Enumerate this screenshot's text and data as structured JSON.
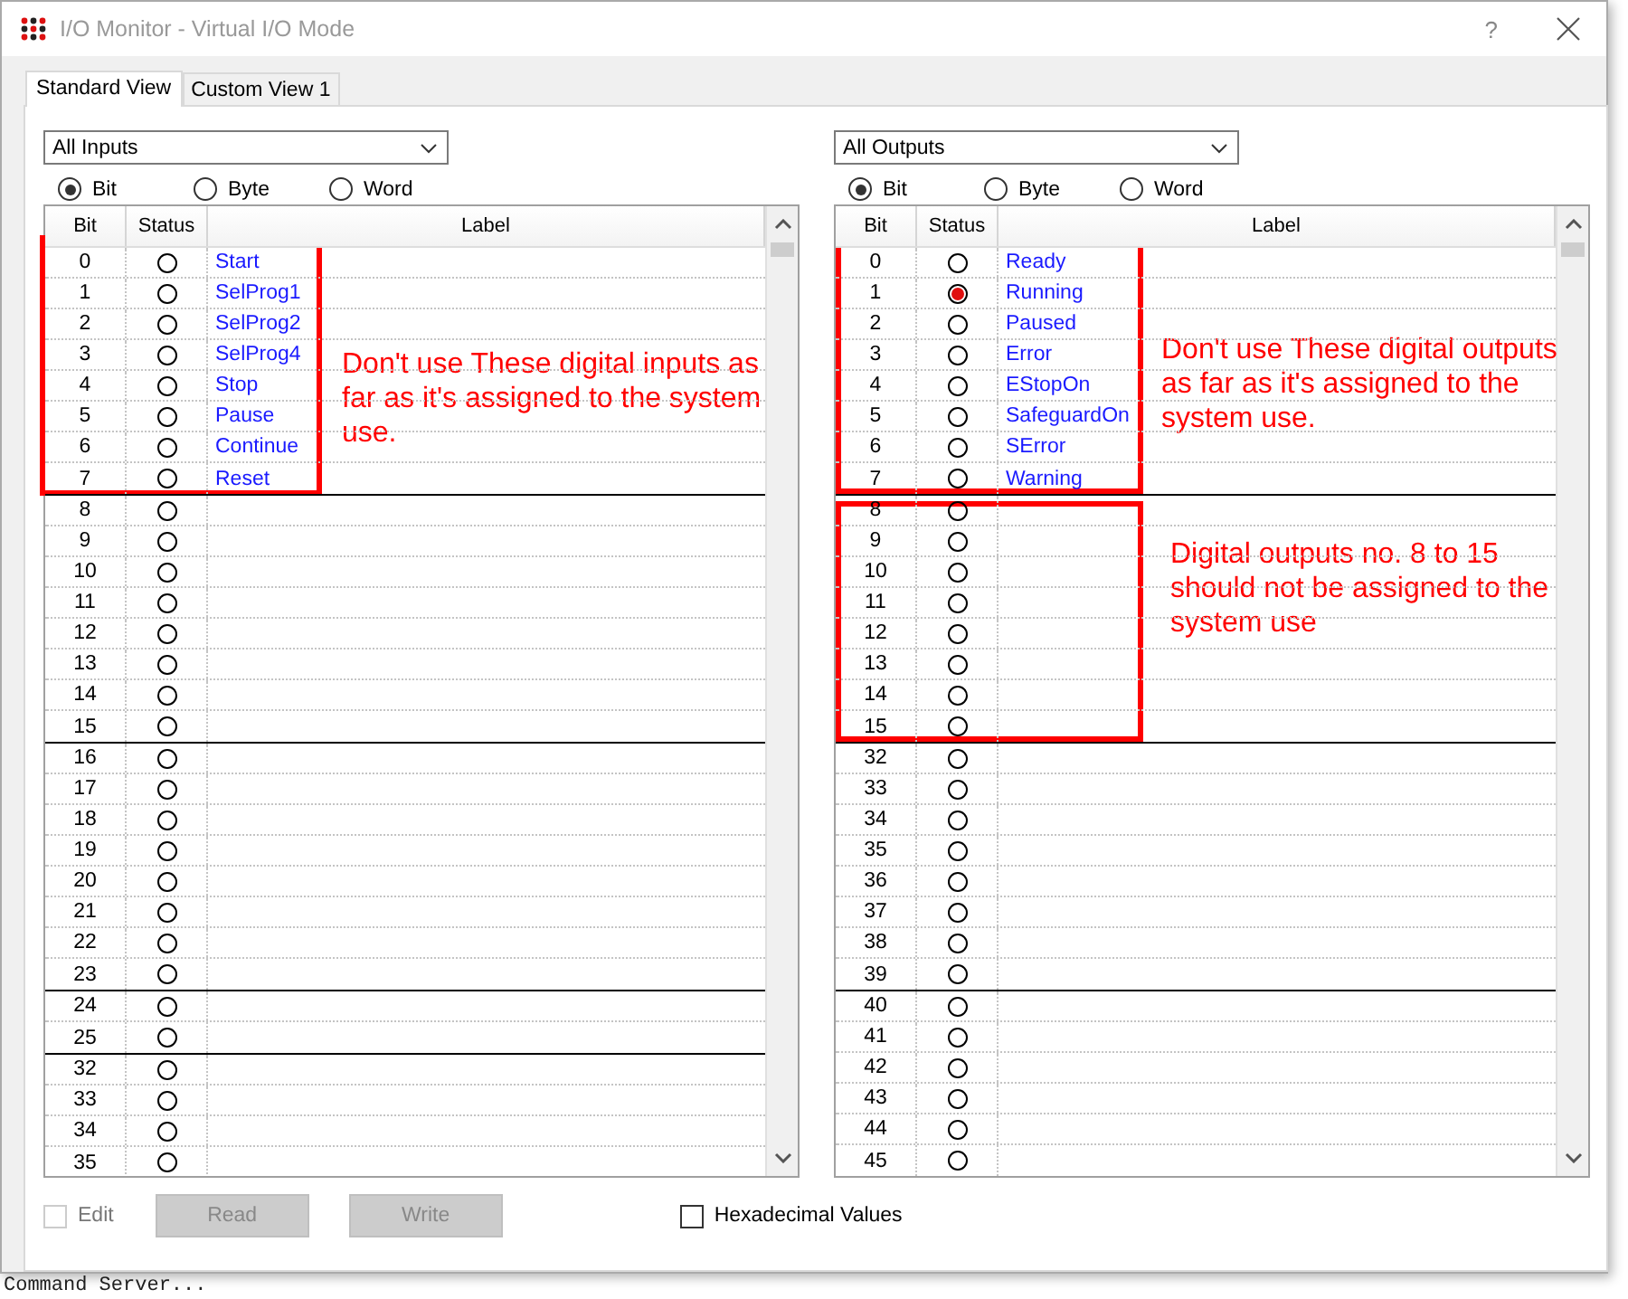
{
  "window": {
    "title": "I/O Monitor - Virtual I/O Mode",
    "help": "?"
  },
  "tabs": [
    {
      "label": "Standard View",
      "selected": true
    },
    {
      "label": "Custom View 1",
      "selected": false
    }
  ],
  "panels": [
    {
      "dropdown": "All Inputs",
      "modes": [
        {
          "label": "Bit",
          "selected": true
        },
        {
          "label": "Byte",
          "selected": false
        },
        {
          "label": "Word",
          "selected": false
        }
      ],
      "columns": [
        "Bit",
        "Status",
        "Label"
      ],
      "groups": [
        {
          "rows": [
            {
              "bit": "0",
              "on": false,
              "label": "Start"
            },
            {
              "bit": "1",
              "on": false,
              "label": "SelProg1"
            },
            {
              "bit": "2",
              "on": false,
              "label": "SelProg2"
            },
            {
              "bit": "3",
              "on": false,
              "label": "SelProg4"
            },
            {
              "bit": "4",
              "on": false,
              "label": "Stop"
            },
            {
              "bit": "5",
              "on": false,
              "label": "Pause"
            },
            {
              "bit": "6",
              "on": false,
              "label": "Continue"
            },
            {
              "bit": "7",
              "on": false,
              "label": "Reset"
            }
          ]
        },
        {
          "rows": [
            {
              "bit": "8",
              "on": false
            },
            {
              "bit": "9",
              "on": false
            },
            {
              "bit": "10",
              "on": false
            },
            {
              "bit": "11",
              "on": false
            },
            {
              "bit": "12",
              "on": false
            },
            {
              "bit": "13",
              "on": false
            },
            {
              "bit": "14",
              "on": false
            },
            {
              "bit": "15",
              "on": false
            }
          ]
        },
        {
          "rows": [
            {
              "bit": "16",
              "on": false
            },
            {
              "bit": "17",
              "on": false
            },
            {
              "bit": "18",
              "on": false
            },
            {
              "bit": "19",
              "on": false
            },
            {
              "bit": "20",
              "on": false
            },
            {
              "bit": "21",
              "on": false
            },
            {
              "bit": "22",
              "on": false
            },
            {
              "bit": "23",
              "on": false
            }
          ]
        },
        {
          "rows": [
            {
              "bit": "24",
              "on": false
            },
            {
              "bit": "25",
              "on": false
            }
          ]
        },
        {
          "rows": [
            {
              "bit": "32",
              "on": false
            },
            {
              "bit": "33",
              "on": false
            },
            {
              "bit": "34",
              "on": false
            },
            {
              "bit": "35",
              "on": false
            }
          ]
        }
      ],
      "annotations": [
        {
          "kind": "box"
        },
        {
          "kind": "note",
          "text": "Don't use These digital inputs as far as it's assigned to the system use."
        }
      ]
    },
    {
      "dropdown": "All Outputs",
      "modes": [
        {
          "label": "Bit",
          "selected": true
        },
        {
          "label": "Byte",
          "selected": false
        },
        {
          "label": "Word",
          "selected": false
        }
      ],
      "columns": [
        "Bit",
        "Status",
        "Label"
      ],
      "groups": [
        {
          "rows": [
            {
              "bit": "0",
              "on": false,
              "label": "Ready"
            },
            {
              "bit": "1",
              "on": true,
              "label": "Running"
            },
            {
              "bit": "2",
              "on": false,
              "label": "Paused"
            },
            {
              "bit": "3",
              "on": false,
              "label": "Error"
            },
            {
              "bit": "4",
              "on": false,
              "label": "EStopOn"
            },
            {
              "bit": "5",
              "on": false,
              "label": "SafeguardOn"
            },
            {
              "bit": "6",
              "on": false,
              "label": "SError"
            },
            {
              "bit": "7",
              "on": false,
              "label": "Warning"
            }
          ]
        },
        {
          "rows": [
            {
              "bit": "8",
              "on": false
            },
            {
              "bit": "9",
              "on": false
            },
            {
              "bit": "10",
              "on": false
            },
            {
              "bit": "11",
              "on": false
            },
            {
              "bit": "12",
              "on": false
            },
            {
              "bit": "13",
              "on": false
            },
            {
              "bit": "14",
              "on": false
            },
            {
              "bit": "15",
              "on": false
            }
          ]
        },
        {
          "rows": [
            {
              "bit": "32",
              "on": false
            },
            {
              "bit": "33",
              "on": false
            },
            {
              "bit": "34",
              "on": false
            },
            {
              "bit": "35",
              "on": false
            },
            {
              "bit": "36",
              "on": false
            },
            {
              "bit": "37",
              "on": false
            },
            {
              "bit": "38",
              "on": false
            },
            {
              "bit": "39",
              "on": false
            }
          ]
        },
        {
          "rows": [
            {
              "bit": "40",
              "on": false
            },
            {
              "bit": "41",
              "on": false
            },
            {
              "bit": "42",
              "on": false
            },
            {
              "bit": "43",
              "on": false
            },
            {
              "bit": "44",
              "on": false
            },
            {
              "bit": "45",
              "on": false
            }
          ]
        }
      ],
      "annotations": [
        {
          "kind": "box"
        },
        {
          "kind": "note",
          "text": "Don't use These digital outputs as far as it's assigned to the system use."
        },
        {
          "kind": "box"
        },
        {
          "kind": "note",
          "text": "Digital outputs no. 8 to 15 should not be assigned to the system use"
        }
      ]
    }
  ],
  "edit": {
    "label": "Edit",
    "checked": false,
    "disabled": true
  },
  "buttons": [
    {
      "label": "Read",
      "disabled": true
    },
    {
      "label": "Write",
      "disabled": true
    }
  ],
  "hex": {
    "label": "Hexadecimal Values",
    "checked": false
  },
  "background_text": "Command Server..."
}
